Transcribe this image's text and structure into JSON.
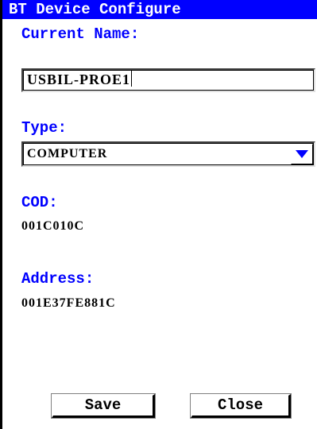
{
  "window": {
    "title": "BT Device Configure"
  },
  "fields": {
    "current_name": {
      "label": "Current Name:",
      "value": "USBIL-PROE1"
    },
    "type": {
      "label": "Type:",
      "selected": "COMPUTER"
    },
    "cod": {
      "label": "COD:",
      "value": "001C010C"
    },
    "address": {
      "label": "Address:",
      "value": "001E37FE881C"
    }
  },
  "buttons": {
    "save_label": "Save",
    "close_label": "Close"
  },
  "colors": {
    "title_bar": "#0000ff",
    "title_text": "#ffffff",
    "label_text": "#0000ff",
    "dropdown_arrow": "#0000ff"
  },
  "icons": {
    "dropdown": "chevron-down-icon"
  }
}
